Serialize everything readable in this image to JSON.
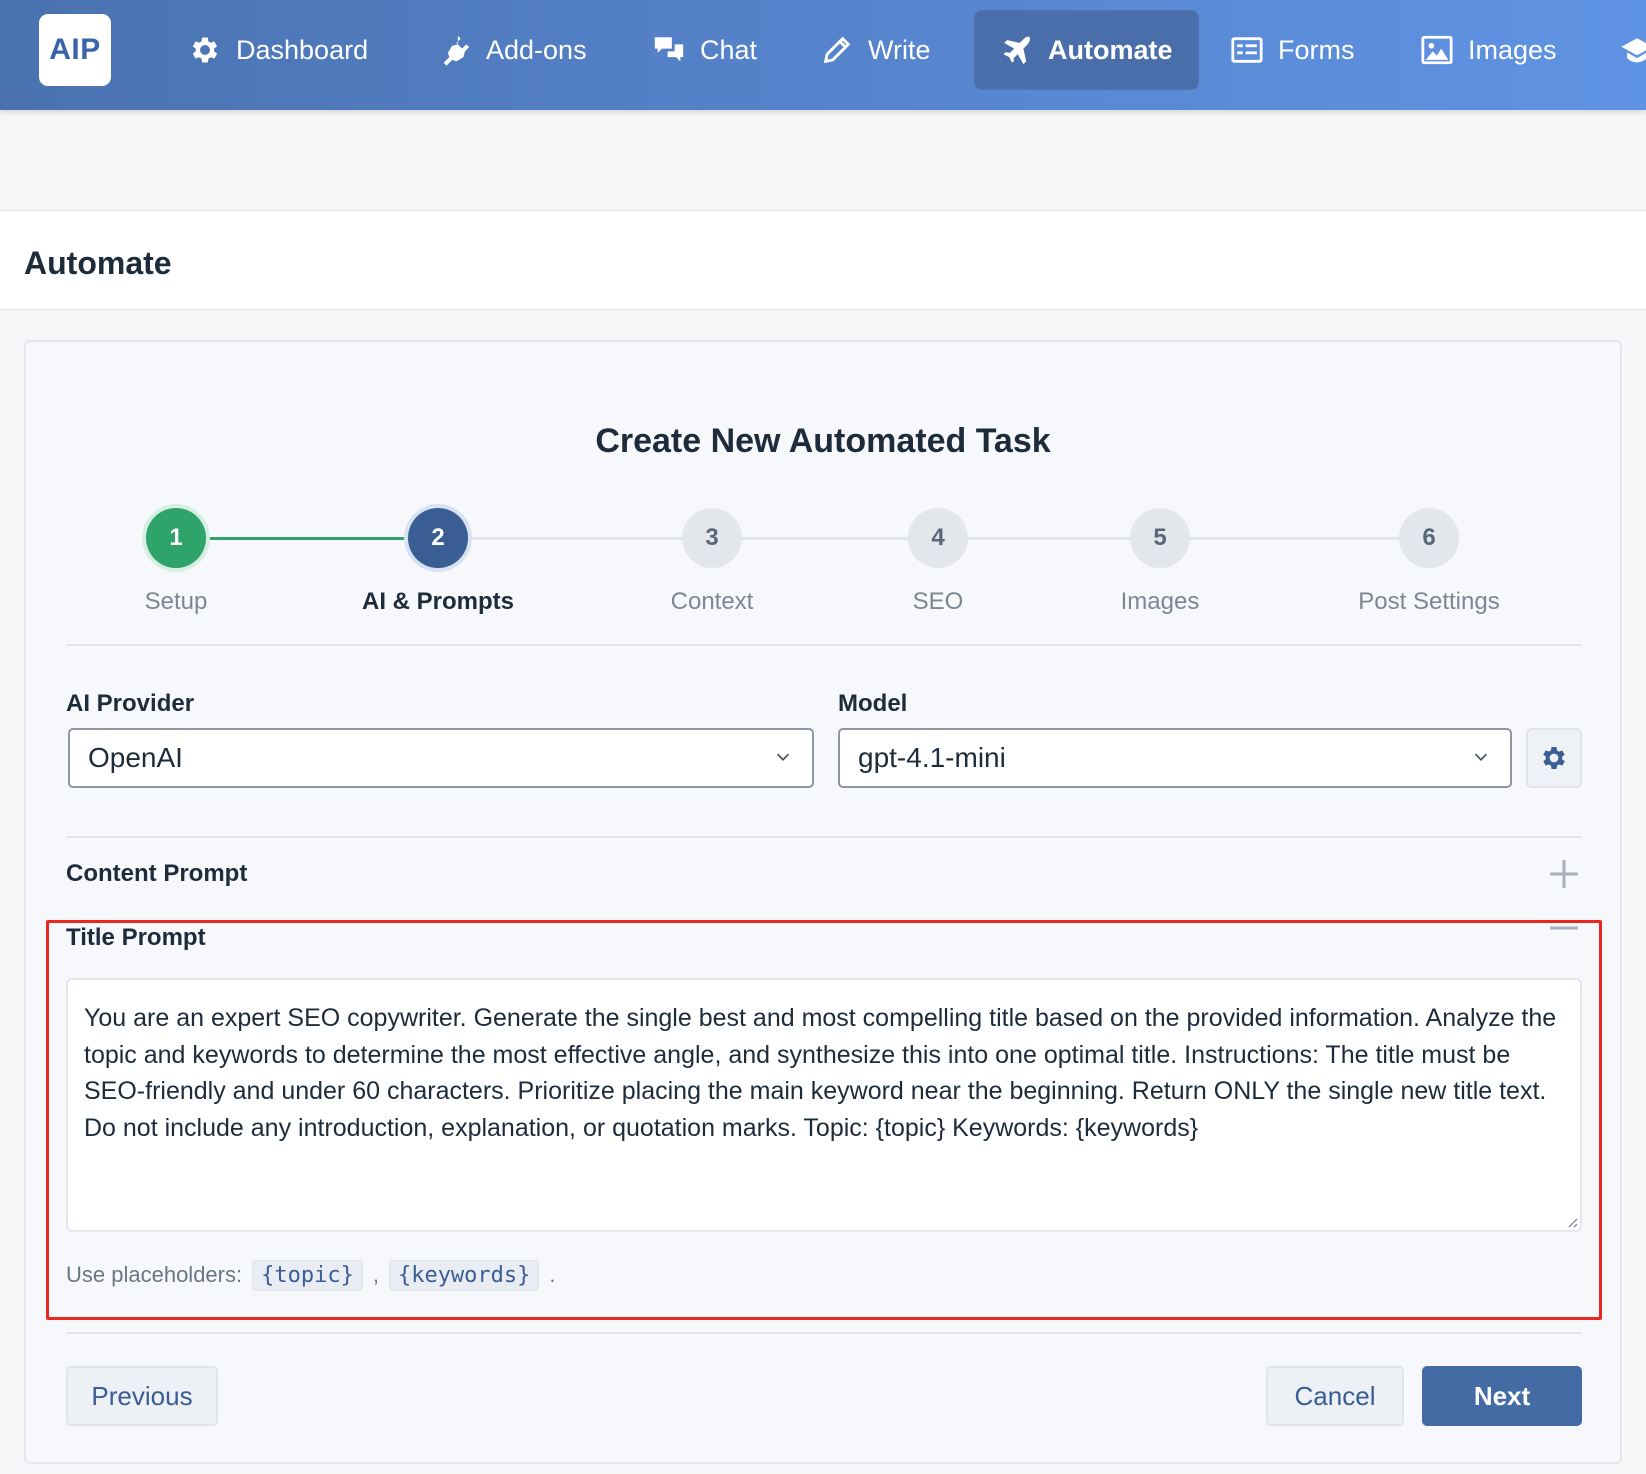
{
  "app": {
    "logo": "AIP"
  },
  "nav": {
    "items": [
      {
        "label": "Dashboard",
        "icon": "gear-icon"
      },
      {
        "label": "Add-ons",
        "icon": "plugin-icon"
      },
      {
        "label": "Chat",
        "icon": "chat-bubbles-icon"
      },
      {
        "label": "Write",
        "icon": "pencil-icon"
      },
      {
        "label": "Automate",
        "icon": "plane-icon",
        "active": true
      },
      {
        "label": "Forms",
        "icon": "form-icon"
      },
      {
        "label": "Images",
        "icon": "image-icon"
      }
    ]
  },
  "page": {
    "title": "Automate"
  },
  "wizard": {
    "title": "Create New Automated Task",
    "steps": [
      {
        "number": "1",
        "label": "Setup",
        "state": "done"
      },
      {
        "number": "2",
        "label": "AI & Prompts",
        "state": "current"
      },
      {
        "number": "3",
        "label": "Context",
        "state": "pending"
      },
      {
        "number": "4",
        "label": "SEO",
        "state": "pending"
      },
      {
        "number": "5",
        "label": "Images",
        "state": "pending"
      },
      {
        "number": "6",
        "label": "Post Settings",
        "state": "pending"
      }
    ],
    "provider": {
      "label": "AI Provider",
      "value": "OpenAI"
    },
    "model": {
      "label": "Model",
      "value": "gpt-4.1-mini"
    },
    "content_prompt": {
      "label": "Content Prompt"
    },
    "title_prompt": {
      "label": "Title Prompt",
      "value": "You are an expert SEO copywriter. Generate the single best and most compelling title based on the provided information. Analyze the topic and keywords to determine the most effective angle, and synthesize this into one optimal title. Instructions: The title must be SEO-friendly and under 60 characters. Prioritize placing the main keyword near the beginning. Return ONLY the single new title text. Do not include any introduction, explanation, or quotation marks. Topic: {topic} Keywords: {keywords}",
      "help_prefix": "Use placeholders:",
      "placeholders": [
        "{topic}",
        "{keywords}"
      ],
      "separator": ",",
      "suffix": "."
    },
    "buttons": {
      "previous": "Previous",
      "cancel": "Cancel",
      "next": "Next"
    }
  },
  "colors": {
    "accent": "#456ba4",
    "done": "#2ea36a",
    "highlight": "#e8281b"
  }
}
